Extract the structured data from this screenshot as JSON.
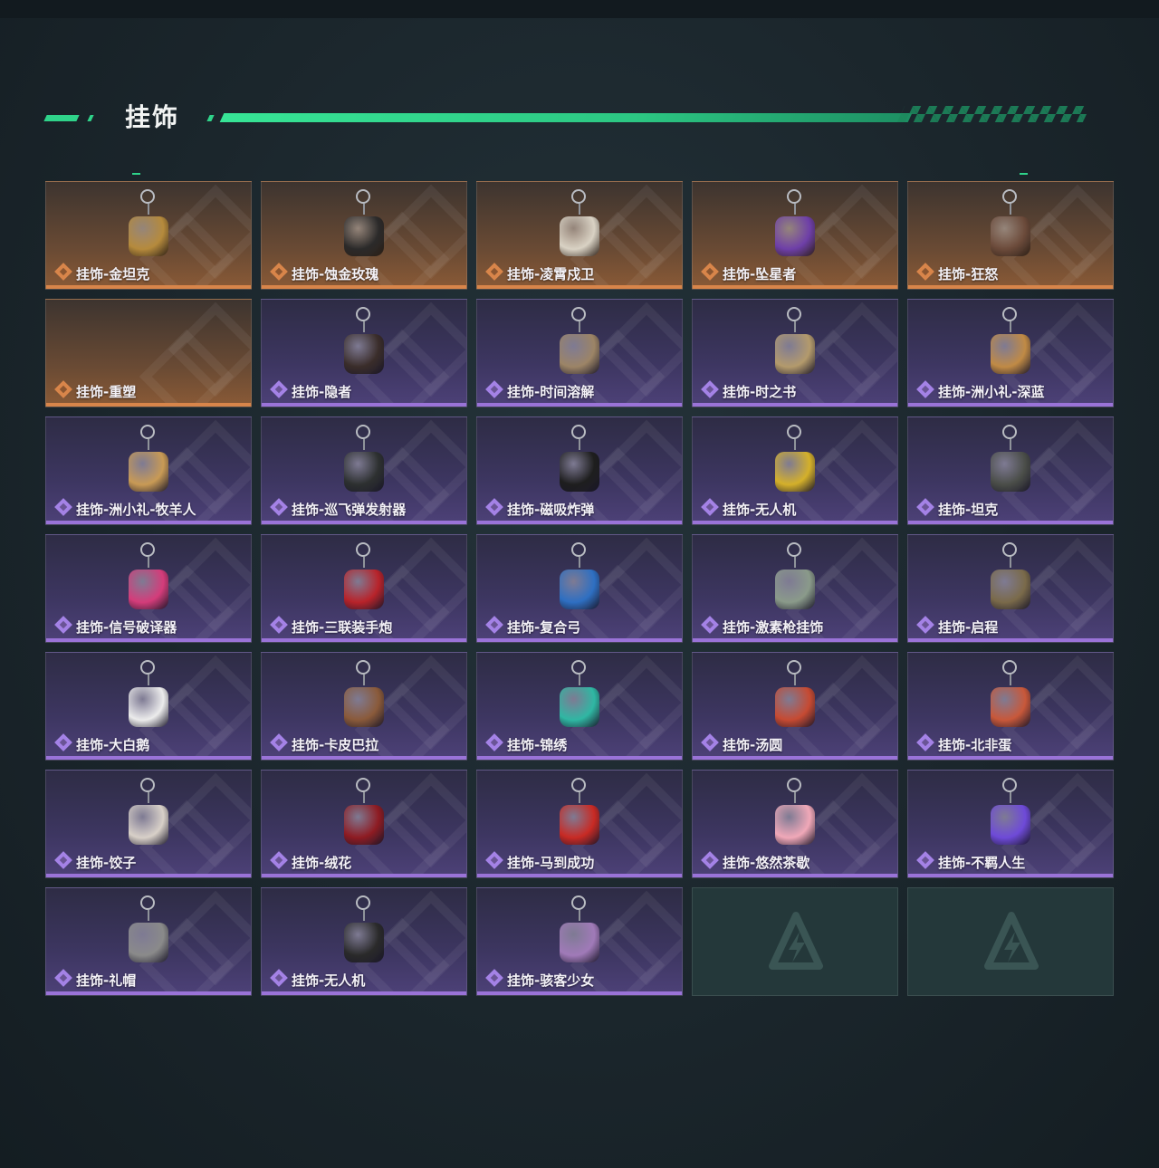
{
  "header": {
    "title": "挂饰"
  },
  "items": [
    {
      "label": "挂饰-金坦克",
      "rarity": "gold",
      "color": "#b58a3c"
    },
    {
      "label": "挂饰-蚀金玫瑰",
      "rarity": "gold",
      "color": "#2b2a2a"
    },
    {
      "label": "挂饰-凌霄戍卫",
      "rarity": "gold",
      "color": "#d9d2c4"
    },
    {
      "label": "挂饰-坠星者",
      "rarity": "gold",
      "color": "#6e3fa8"
    },
    {
      "label": "挂饰-狂怒",
      "rarity": "gold",
      "color": "#6b4a3a"
    },
    {
      "label": "挂饰-重塑",
      "rarity": "gold",
      "color": ""
    },
    {
      "label": "挂饰-隐者",
      "rarity": "purple",
      "color": "#3a2d2a"
    },
    {
      "label": "挂饰-时间溶解",
      "rarity": "purple",
      "color": "#9c8466"
    },
    {
      "label": "挂饰-时之书",
      "rarity": "purple",
      "color": "#b39a6c"
    },
    {
      "label": "挂饰-洲小礼-深蓝",
      "rarity": "purple",
      "color": "#c08a45"
    },
    {
      "label": "挂饰-洲小礼-牧羊人",
      "rarity": "purple",
      "color": "#c89a55"
    },
    {
      "label": "挂饰-巡飞弹发射器",
      "rarity": "purple",
      "color": "#2d3030"
    },
    {
      "label": "挂饰-磁吸炸弹",
      "rarity": "purple",
      "color": "#1e1e1e"
    },
    {
      "label": "挂饰-无人机",
      "rarity": "purple",
      "color": "#d4b02a"
    },
    {
      "label": "挂饰-坦克",
      "rarity": "purple",
      "color": "#4a4d48"
    },
    {
      "label": "挂饰-信号破译器",
      "rarity": "purple",
      "color": "#d43c7a"
    },
    {
      "label": "挂饰-三联装手炮",
      "rarity": "purple",
      "color": "#b8232a"
    },
    {
      "label": "挂饰-复合弓",
      "rarity": "purple",
      "color": "#2e6fc2"
    },
    {
      "label": "挂饰-激素枪挂饰",
      "rarity": "purple",
      "color": "#8a9a8a"
    },
    {
      "label": "挂饰-启程",
      "rarity": "purple",
      "color": "#7a6a4a"
    },
    {
      "label": "挂饰-大白鹅",
      "rarity": "purple",
      "color": "#ececec"
    },
    {
      "label": "挂饰-卡皮巴拉",
      "rarity": "purple",
      "color": "#8a5a3a"
    },
    {
      "label": "挂饰-锦绣",
      "rarity": "purple",
      "color": "#2fb7a3"
    },
    {
      "label": "挂饰-汤圆",
      "rarity": "purple",
      "color": "#c64a32"
    },
    {
      "label": "挂饰-北非蛋",
      "rarity": "purple",
      "color": "#c8583a"
    },
    {
      "label": "挂饰-饺子",
      "rarity": "purple",
      "color": "#d8d0c8"
    },
    {
      "label": "挂饰-绒花",
      "rarity": "purple",
      "color": "#8e1b22"
    },
    {
      "label": "挂饰-马到成功",
      "rarity": "purple",
      "color": "#c82a24"
    },
    {
      "label": "挂饰-悠然茶歇",
      "rarity": "purple",
      "color": "#f0a8b8"
    },
    {
      "label": "挂饰-不羁人生",
      "rarity": "purple",
      "color": "#6e4ad8"
    },
    {
      "label": "挂饰-礼帽",
      "rarity": "purple",
      "color": "#8a8a8a"
    },
    {
      "label": "挂饰-无人机",
      "rarity": "purple",
      "color": "#2a2a2a"
    },
    {
      "label": "挂饰-骇客少女",
      "rarity": "purple",
      "color": "#a07ab8"
    },
    {
      "label": "",
      "rarity": "empty",
      "color": ""
    },
    {
      "label": "",
      "rarity": "empty",
      "color": ""
    }
  ]
}
